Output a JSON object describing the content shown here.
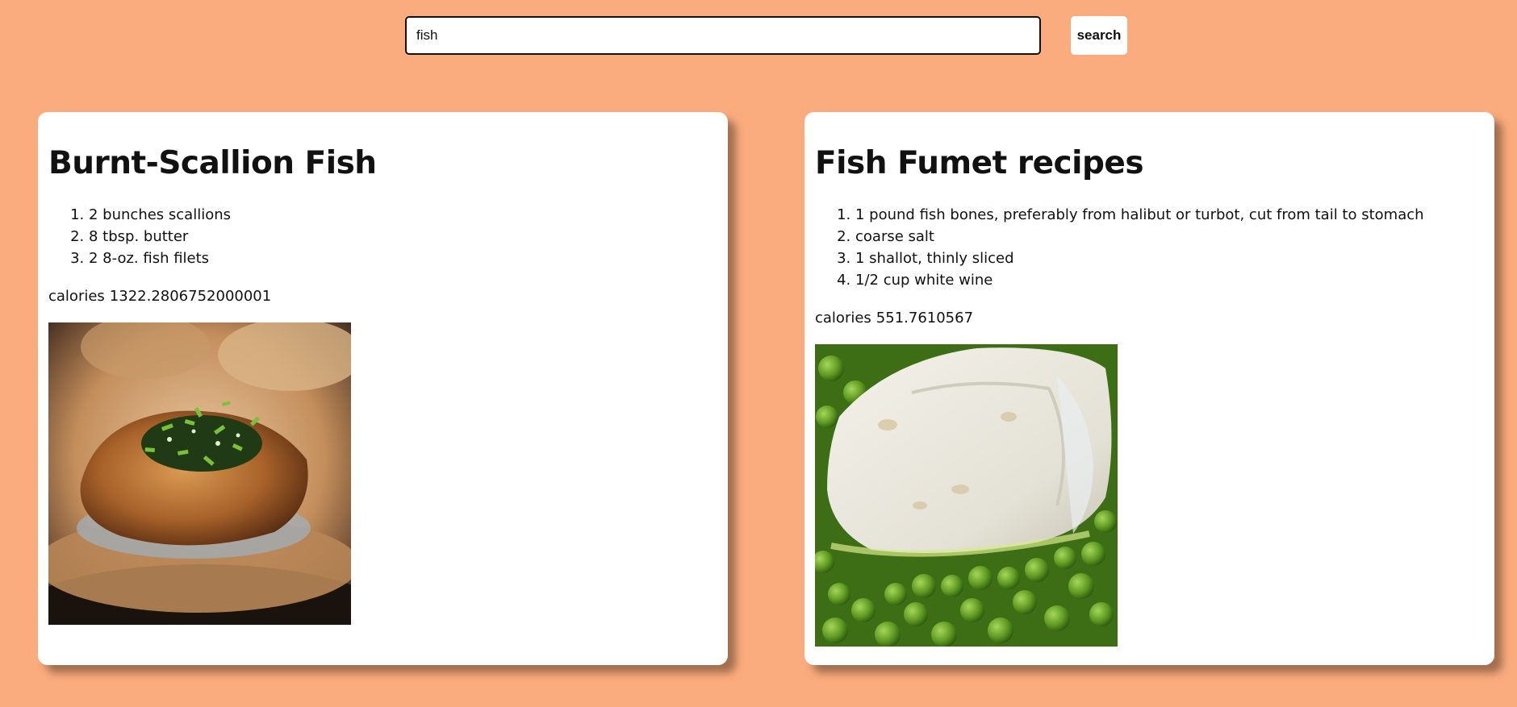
{
  "search": {
    "value": "fish",
    "button_label": "search"
  },
  "recipes": [
    {
      "title": "Burnt-Scallion Fish",
      "ingredients": [
        "2 bunches scallions",
        "8 tbsp. butter",
        "2 8-oz. fish filets"
      ],
      "calories_label": "calories",
      "calories_value": "1322.2806752000001",
      "photo": "pan-seared fish topped with charred scallions"
    },
    {
      "title": "Fish Fumet recipes",
      "ingredients": [
        "1 pound fish bones, preferably from halibut or turbot, cut from tail to stomach",
        "coarse salt",
        "1 shallot, thinly sliced",
        "1/2 cup white wine"
      ],
      "calories_label": "calories",
      "calories_value": "551.7610567",
      "photo": "white fish filet on a bed of green peas"
    }
  ]
}
